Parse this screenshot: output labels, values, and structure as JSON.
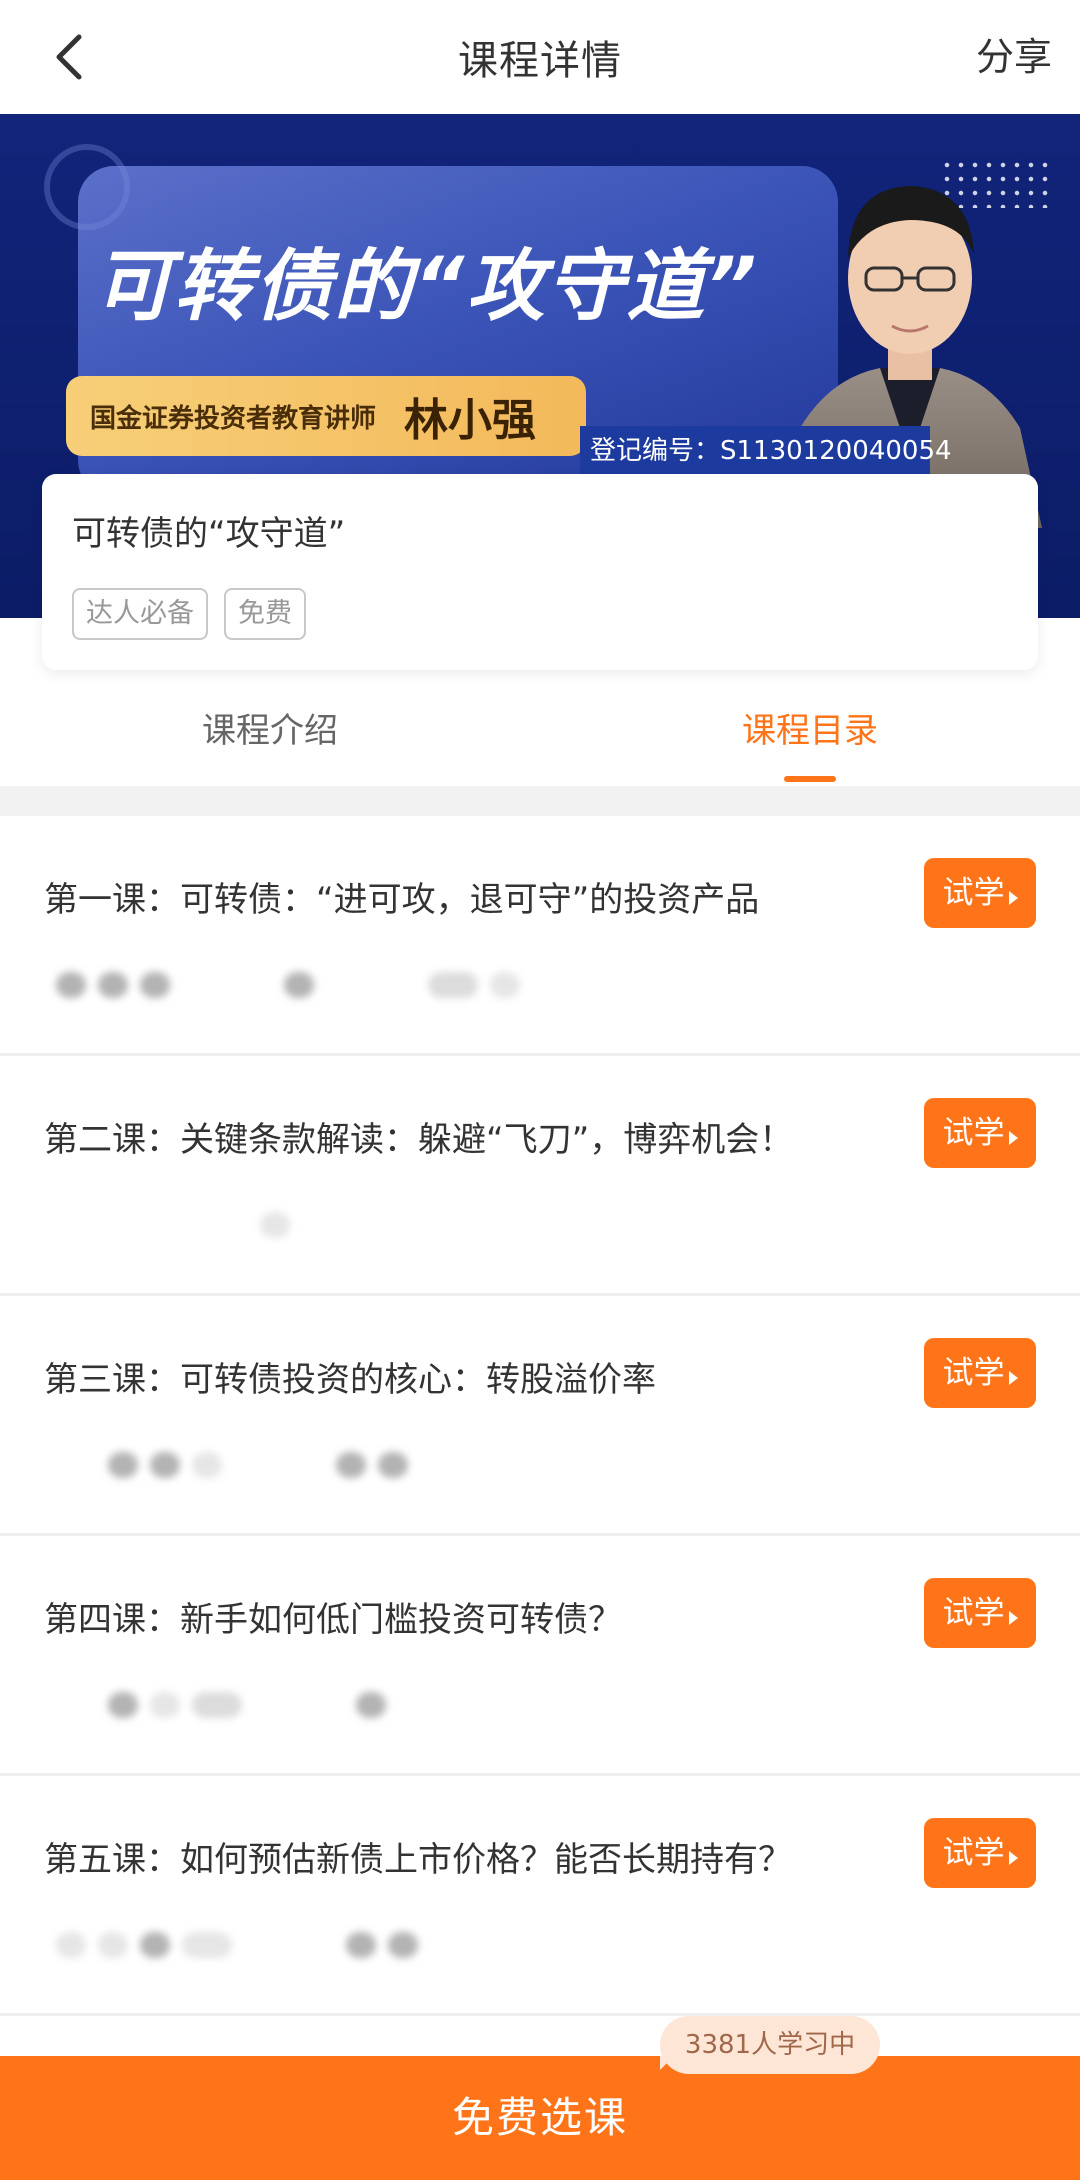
{
  "header": {
    "title": "课程详情",
    "share_label": "分享"
  },
  "banner": {
    "headline": "可转债的“攻守道”",
    "org_label": "国金证券投资者教育讲师",
    "lecturer_name": "林小强",
    "registration": "登记编号：S1130120040054",
    "colors": {
      "background": "#0f2170",
      "label": "#f5c46a"
    }
  },
  "course": {
    "name": "可转债的“攻守道”",
    "tags": [
      "达人必备",
      "免费"
    ]
  },
  "tabs": [
    {
      "label": "课程介绍",
      "active": false
    },
    {
      "label": "课程目录",
      "active": true
    }
  ],
  "lessons": [
    {
      "title": "第一课：可转债：“进可攻，退可守”的投资产品",
      "button": "试学"
    },
    {
      "title": "第二课：关键条款解读：躲避“飞刀”，博弈机会！",
      "button": "试学"
    },
    {
      "title": "第三课：可转债投资的核心：转股溢价率",
      "button": "试学"
    },
    {
      "title": "第四课：新手如何低门槛投资可转债？",
      "button": "试学"
    },
    {
      "title": "第五课：如何预估新债上市价格？能否长期持有？",
      "button": "试学"
    }
  ],
  "learning_count": "3381人学习中",
  "bottom_button": "免费选课",
  "accent_color": "#ff7418",
  "icons": {
    "back": "chevron-left-icon",
    "play": "play-icon",
    "trial_arrow": "triangle-right-icon"
  }
}
